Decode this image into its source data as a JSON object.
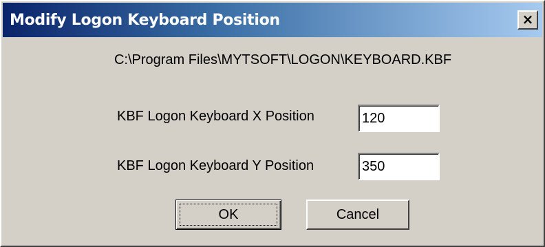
{
  "window": {
    "title": "Modify Logon Keyboard Position",
    "close_symbol": "×",
    "close_icon": "close-icon"
  },
  "file_path": "C:\\Program Files\\MYTSOFT\\LOGON\\KEYBOARD.KBF",
  "fields": {
    "x": {
      "label": "KBF Logon Keyboard X Position",
      "value": "120"
    },
    "y": {
      "label": "KBF Logon Keyboard Y Position",
      "value": "350"
    }
  },
  "buttons": {
    "ok_label": "OK",
    "cancel_label": "Cancel"
  },
  "colors": {
    "title_gradient_start": "#0a246a",
    "title_gradient_end": "#a6caf0",
    "face": "#d4d0c8"
  }
}
